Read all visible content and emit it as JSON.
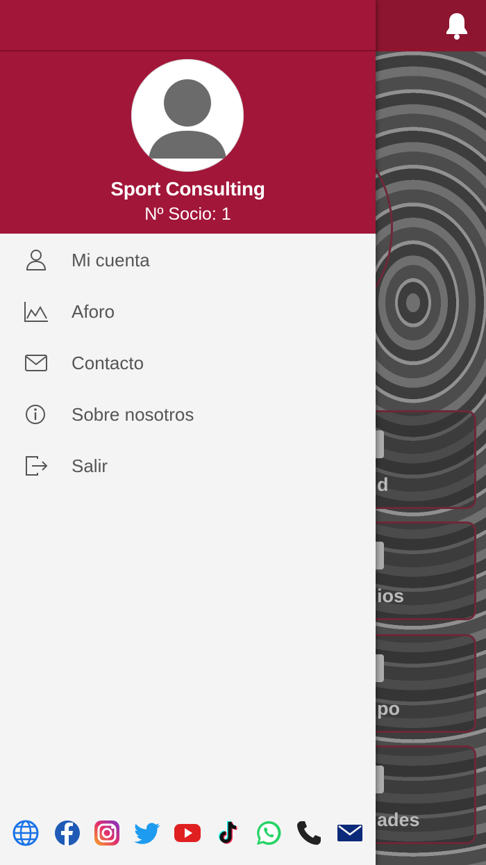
{
  "app": {
    "tiles": [
      {
        "label": "d"
      },
      {
        "label": "ios"
      },
      {
        "label": "po"
      },
      {
        "label": "ades"
      }
    ],
    "icons": {
      "bell": "bell-icon"
    },
    "colors": {
      "brand": "#a21639",
      "brand_dark": "#8e1530",
      "drawer_bg": "#f4f4f4",
      "menu_text": "#555555"
    }
  },
  "drawer": {
    "user": {
      "name": "Sport Consulting",
      "member_number": "Nº Socio: 1"
    },
    "menu": [
      {
        "label": "Mi cuenta",
        "icon": "user-icon"
      },
      {
        "label": "Aforo",
        "icon": "chart-icon"
      },
      {
        "label": "Contacto",
        "icon": "mail-icon"
      },
      {
        "label": "Sobre nosotros",
        "icon": "info-icon"
      },
      {
        "label": "Salir",
        "icon": "logout-icon"
      }
    ],
    "social": [
      "globe-icon",
      "facebook-icon",
      "instagram-icon",
      "twitter-icon",
      "youtube-icon",
      "tiktok-icon",
      "whatsapp-icon",
      "phone-icon",
      "email-icon"
    ]
  }
}
